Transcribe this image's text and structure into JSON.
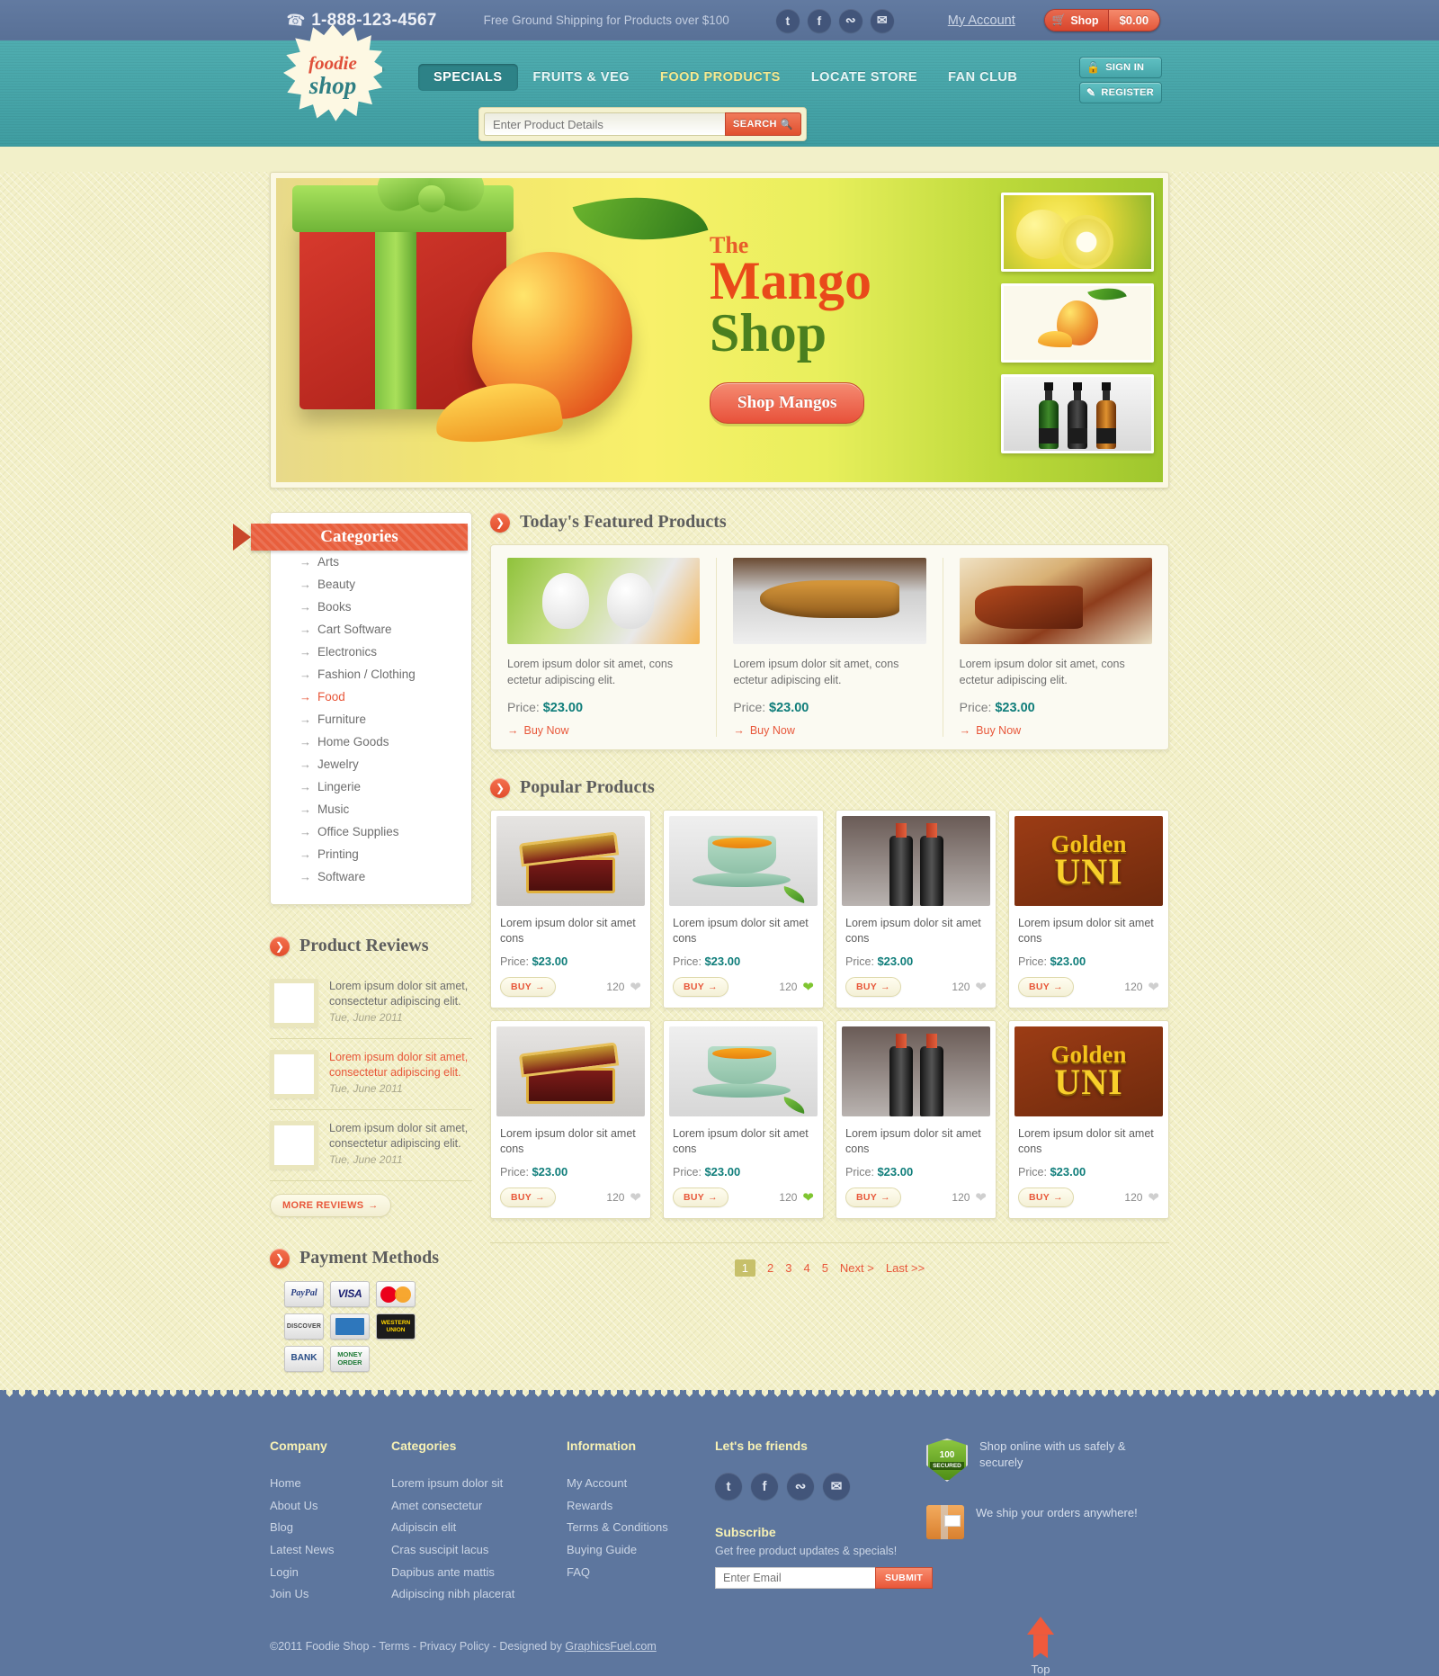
{
  "topbar": {
    "phone": "1-888-123-4567",
    "shipping_msg": "Free Ground Shipping for Products over $100",
    "my_account": "My Account",
    "cart_label": "Shop",
    "cart_total": "$0.00",
    "social": [
      {
        "name": "twitter-icon",
        "glyph": "t"
      },
      {
        "name": "facebook-icon",
        "glyph": "f"
      },
      {
        "name": "rss-icon",
        "glyph": "≋"
      },
      {
        "name": "email-icon",
        "glyph": "✉"
      }
    ]
  },
  "header": {
    "logo_line1": "foodie",
    "logo_line2": "shop",
    "nav": [
      {
        "label": "SPECIALS",
        "state": "active"
      },
      {
        "label": "FRUITS & VEG",
        "state": "normal"
      },
      {
        "label": "FOOD PRODUCTS",
        "state": "highlight"
      },
      {
        "label": "LOCATE STORE",
        "state": "normal"
      },
      {
        "label": "FAN CLUB",
        "state": "normal"
      }
    ],
    "sign_in": "SIGN IN",
    "register": "REGISTER",
    "search_placeholder": "Enter Product Details",
    "search_button": "SEARCH"
  },
  "banner": {
    "eyebrow": "The",
    "title_line1": "Mango",
    "title_line2": "Shop",
    "cta": "Shop Mangos",
    "thumbs": [
      "lemons-thumbnail",
      "mango-thumbnail",
      "bottles-thumbnail"
    ]
  },
  "sidebar": {
    "categories_title": "Categories",
    "categories": [
      {
        "label": "Arts",
        "selected": false
      },
      {
        "label": "Beauty",
        "selected": false
      },
      {
        "label": "Books",
        "selected": false
      },
      {
        "label": "Cart Software",
        "selected": false
      },
      {
        "label": "Electronics",
        "selected": false
      },
      {
        "label": "Fashion / Clothing",
        "selected": false
      },
      {
        "label": "Food",
        "selected": true
      },
      {
        "label": "Furniture",
        "selected": false
      },
      {
        "label": "Home Goods",
        "selected": false
      },
      {
        "label": "Jewelry",
        "selected": false
      },
      {
        "label": "Lingerie",
        "selected": false
      },
      {
        "label": "Music",
        "selected": false
      },
      {
        "label": "Office Supplies",
        "selected": false
      },
      {
        "label": "Printing",
        "selected": false
      },
      {
        "label": "Software",
        "selected": false
      }
    ],
    "reviews_title": "Product Reviews",
    "reviews": [
      {
        "text": "Lorem ipsum dolor sit amet, consectetur adipiscing elit.",
        "date": "Tue, June 2011",
        "highlight": false
      },
      {
        "text": "Lorem ipsum dolor sit amet, consectetur adipiscing elit.",
        "date": "Tue, June 2011",
        "highlight": true
      },
      {
        "text": "Lorem ipsum dolor sit amet, consectetur adipiscing elit.",
        "date": "Tue, June 2011",
        "highlight": false
      }
    ],
    "more_reviews": "MORE REVIEWS",
    "payments_title": "Payment Methods",
    "payment_methods": [
      "PayPal",
      "VISA",
      "MasterCard",
      "DISCOVER",
      "American Express",
      "WESTERN UNION",
      "BANK",
      "MONEY ORDER"
    ]
  },
  "featured": {
    "title": "Today's Featured Products",
    "price_label": "Price:",
    "buy_label": "Buy Now",
    "items": [
      {
        "desc": "Lorem ipsum dolor sit amet, cons ectetur adipiscing elit.",
        "price": "$23.00",
        "image": "sheep-figurines"
      },
      {
        "desc": "Lorem ipsum dolor sit amet, cons ectetur adipiscing elit.",
        "price": "$23.00",
        "image": "wooden-fish"
      },
      {
        "desc": "Lorem ipsum dolor sit amet, cons ectetur adipiscing elit.",
        "price": "$23.00",
        "image": "wooden-toy"
      }
    ]
  },
  "popular": {
    "title": "Popular Products",
    "price_label": "Price:",
    "buy_label": "BUY",
    "items": [
      {
        "name": "Lorem ipsum dolor sit amet cons",
        "price": "$23.00",
        "likes": "120",
        "liked": false,
        "image": "treasure-chest"
      },
      {
        "name": "Lorem ipsum dolor sit amet cons",
        "price": "$23.00",
        "likes": "120",
        "liked": true,
        "image": "tea-cup"
      },
      {
        "name": "Lorem ipsum dolor sit amet cons",
        "price": "$23.00",
        "likes": "120",
        "liked": false,
        "image": "wine-bottles"
      },
      {
        "name": "Lorem ipsum dolor sit amet cons",
        "price": "$23.00",
        "likes": "120",
        "liked": false,
        "image": "golden-uni",
        "title1": "Golden",
        "title2": "UNI"
      },
      {
        "name": "Lorem ipsum dolor sit amet cons",
        "price": "$23.00",
        "likes": "120",
        "liked": false,
        "image": "treasure-chest"
      },
      {
        "name": "Lorem ipsum dolor sit amet cons",
        "price": "$23.00",
        "likes": "120",
        "liked": true,
        "image": "tea-cup"
      },
      {
        "name": "Lorem ipsum dolor sit amet cons",
        "price": "$23.00",
        "likes": "120",
        "liked": false,
        "image": "wine-bottles"
      },
      {
        "name": "Lorem ipsum dolor sit amet cons",
        "price": "$23.00",
        "likes": "120",
        "liked": false,
        "image": "golden-uni",
        "title1": "Golden",
        "title2": "UNI"
      }
    ]
  },
  "pagination": {
    "pages": [
      "1",
      "2",
      "3",
      "4",
      "5"
    ],
    "current": "1",
    "next": "Next >",
    "last": "Last >>"
  },
  "footer": {
    "company": {
      "heading": "Company",
      "links": [
        "Home",
        "About Us",
        "Blog",
        "Latest News",
        "Login",
        "Join Us"
      ]
    },
    "categories": {
      "heading": "Categories",
      "links": [
        "Lorem ipsum dolor sit",
        "Amet consectetur",
        "Adipiscin elit",
        "Cras suscipit lacus",
        "Dapibus ante mattis",
        "Adipiscing nibh placerat"
      ]
    },
    "information": {
      "heading": "Information",
      "links": [
        "My Account",
        "Rewards",
        "Terms & Conditions",
        "Buying Guide",
        "FAQ"
      ]
    },
    "friends": {
      "heading": "Let's be friends",
      "subscribe_heading": "Subscribe",
      "subscribe_text": "Get free product updates & specials!",
      "email_placeholder": "Enter Email",
      "submit_label": "SUBMIT"
    },
    "badges": {
      "secure_percent": "100",
      "secure_word": "SECURED",
      "secure_text": "Shop online with us safely & securely",
      "ship_text": "We ship your orders anywhere!"
    },
    "top_label": "Top",
    "copyright": "©2011 Foodie Shop - Terms - Privacy Policy - Designed by ",
    "copyright_link": "GraphicsFuel.com"
  }
}
